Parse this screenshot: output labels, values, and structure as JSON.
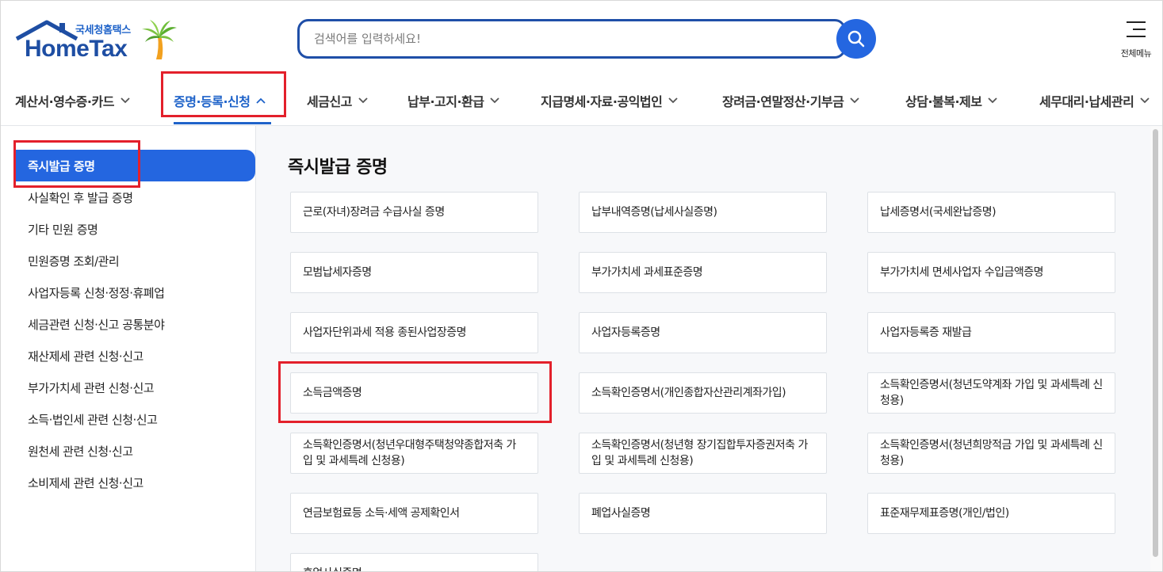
{
  "header": {
    "logo_sub": "국세청홈택스",
    "logo_main": "HomeTax",
    "search_placeholder": "검색어를 입력하세요!",
    "all_menu_label": "전체메뉴"
  },
  "gnb": {
    "items": [
      {
        "label": "계산서·영수증·카드",
        "active": false
      },
      {
        "label": "증명·등록·신청",
        "active": true
      },
      {
        "label": "세금신고",
        "active": false
      },
      {
        "label": "납부·고지·환급",
        "active": false
      },
      {
        "label": "지급명세·자료·공익법인",
        "active": false
      },
      {
        "label": "장려금·연말정산·기부금",
        "active": false
      },
      {
        "label": "상담·불복·제보",
        "active": false
      },
      {
        "label": "세무대리·납세관리",
        "active": false
      }
    ]
  },
  "sidebar": {
    "items": [
      {
        "label": "즉시발급 증명",
        "active": true
      },
      {
        "label": "사실확인 후 발급 증명",
        "active": false
      },
      {
        "label": "기타 민원 증명",
        "active": false
      },
      {
        "label": "민원증명 조회/관리",
        "active": false
      },
      {
        "label": "사업자등록 신청·정정·휴폐업",
        "active": false
      },
      {
        "label": "세금관련 신청·신고 공통분야",
        "active": false
      },
      {
        "label": "재산제세 관련 신청·신고",
        "active": false
      },
      {
        "label": "부가가치세 관련 신청·신고",
        "active": false
      },
      {
        "label": "소득·법인세 관련 신청·신고",
        "active": false
      },
      {
        "label": "원천세 관련 신청·신고",
        "active": false
      },
      {
        "label": "소비제세 관련 신청·신고",
        "active": false
      }
    ]
  },
  "main": {
    "title": "즉시발급 증명",
    "cards": [
      "근로(자녀)장려금 수급사실 증명",
      "납부내역증명(납세사실증명)",
      "납세증명서(국세완납증명)",
      "모범납세자증명",
      "부가가치세 과세표준증명",
      "부가가치세 면세사업자 수입금액증명",
      "사업자단위과세 적용 종된사업장증명",
      "사업자등록증명",
      "사업자등록증 재발급",
      "소득금액증명",
      "소득확인증명서(개인종합자산관리계좌가입)",
      "소득확인증명서(청년도약계좌 가입 및 과세특례 신청용)",
      "소득확인증명서(청년우대형주택청약종합저축 가입 및 과세특례 신청용)",
      "소득확인증명서(청년형 장기집합투자증권저축 가입 및 과세특례 신청용)",
      "소득확인증명서(청년희망적금 가입 및 과세특례 신청용)",
      "연금보험료등 소득·세액 공제확인서",
      "폐업사실증명",
      "표준재무제표증명(개인/법인)",
      "휴업사실증명"
    ]
  },
  "colors": {
    "brand_blue": "#2466e0",
    "highlight_red": "#e3202b"
  }
}
